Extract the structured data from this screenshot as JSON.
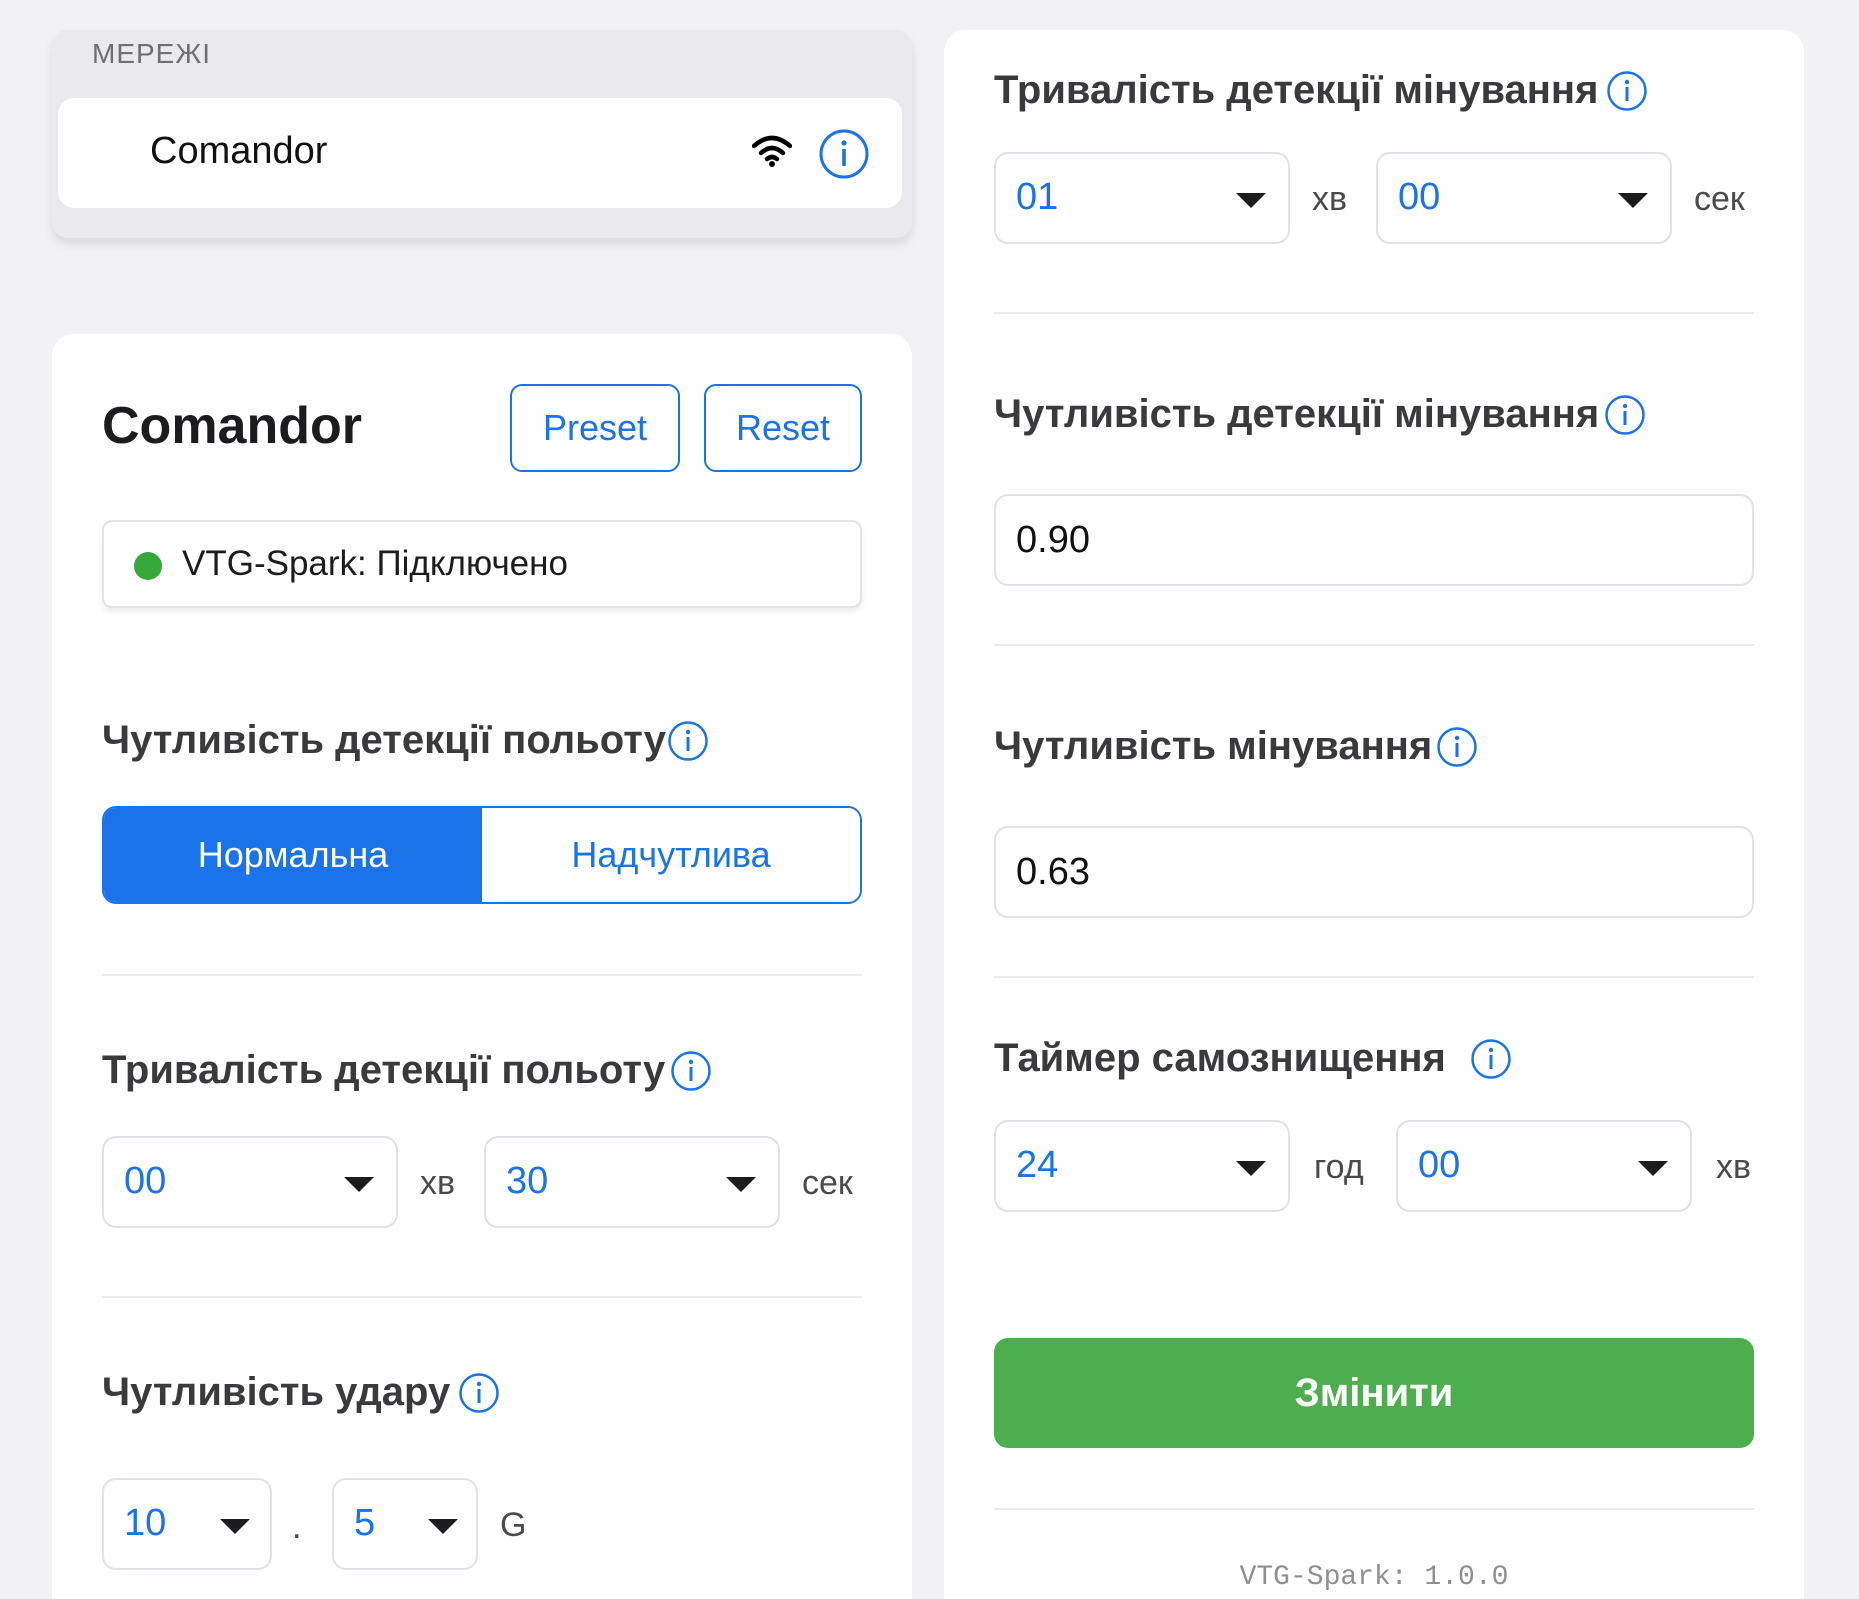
{
  "networks": {
    "header": "МЕРЕЖІ",
    "items": [
      {
        "name": "Comandor"
      }
    ]
  },
  "device": {
    "title": "Comandor",
    "preset_label": "Preset",
    "reset_label": "Reset",
    "status_text": "VTG-Spark: Підключено",
    "status_color": "#34a83a"
  },
  "flight_sensitivity": {
    "label": "Чутливість детекції польоту",
    "options": [
      "Нормальна",
      "Надчутлива"
    ],
    "selected": "Нормальна"
  },
  "flight_duration": {
    "label": "Тривалість детекції польоту",
    "minutes": "00",
    "minutes_unit": "хв",
    "seconds": "30",
    "seconds_unit": "сек"
  },
  "impact_sensitivity": {
    "label": "Чутливість удару",
    "integer": "10",
    "separator": ".",
    "decimal": "5",
    "unit": "G"
  },
  "mining_duration": {
    "label": "Тривалість детекції мінування",
    "minutes": "01",
    "minutes_unit": "хв",
    "seconds": "00",
    "seconds_unit": "сек"
  },
  "mining_detection_sensitivity": {
    "label": "Чутливість детекції мінування",
    "value": "0.90"
  },
  "mining_sensitivity": {
    "label": "Чутливість мінування",
    "value": "0.63"
  },
  "self_destruct_timer": {
    "label": "Таймер самознищення",
    "hours": "24",
    "hours_unit": "год",
    "minutes": "00",
    "minutes_unit": "хв"
  },
  "apply_label": "Змінити",
  "version": "VTG-Spark: 1.0.0",
  "colors": {
    "accent": "#1a73e8",
    "success": "#4cae4c",
    "background": "#f2f2f4"
  }
}
